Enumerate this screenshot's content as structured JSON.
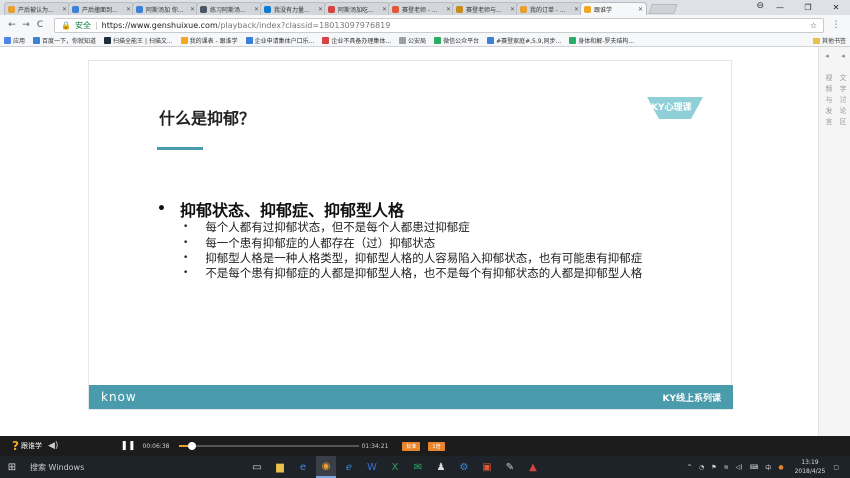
{
  "browser": {
    "tabs": [
      {
        "label": "产后被认为...",
        "icon": "user-icon",
        "color": "#e8a030"
      },
      {
        "label": "产后撞面到...",
        "icon": "paw-icon",
        "color": "#3b82d6"
      },
      {
        "label": "阿斯汤加 你...",
        "icon": "paw-icon",
        "color": "#3b82d6"
      },
      {
        "label": "练习阿斯汤...",
        "icon": "doc-icon",
        "color": "#4b5563"
      },
      {
        "label": "我没有力量...",
        "icon": "zhihu-icon",
        "color": "#0e7bd2"
      },
      {
        "label": "阿斯汤加吃...",
        "icon": "doc-icon",
        "color": "#d64541"
      },
      {
        "label": "赛登老师 - ...",
        "icon": "circle-icon",
        "color": "#e05a3a"
      },
      {
        "label": "赛登老师与...",
        "icon": "book-icon",
        "color": "#c98a1c"
      },
      {
        "label": "我的订单 - ...",
        "icon": "order-icon",
        "color": "#e8a030"
      },
      {
        "label": "跟谁学",
        "icon": "question-icon",
        "color": "#f5a623",
        "active": true
      }
    ],
    "url_secure_label": "安全",
    "url_host": "https://www.genshuixue.com",
    "url_path": "/playback/index?classid=18013097976819",
    "bookmarks": [
      {
        "label": "应用",
        "color": "#4f86e8"
      },
      {
        "label": "百度一下，你就知道",
        "color": "#3b82d6"
      },
      {
        "label": "扫描全能王 | 扫描文...",
        "color": "#1d2b3a"
      },
      {
        "label": "我的课表 - 跟谁学",
        "color": "#f5a623"
      },
      {
        "label": "企业申请集体户口乐...",
        "color": "#3b82d6"
      },
      {
        "label": "企业不具备办理集体...",
        "color": "#d64541"
      },
      {
        "label": "公安局",
        "color": "#9aa0a6"
      },
      {
        "label": "微信公众平台",
        "color": "#2aae67"
      },
      {
        "label": "#赛登家庭#,5.9,同步...",
        "color": "#3b82d6"
      },
      {
        "label": "身体和解-罗夫结构...",
        "color": "#2aae67"
      }
    ],
    "other_bookmarks": "其他书签"
  },
  "slide": {
    "title": "什么是抑郁？",
    "logo": "KY心理课",
    "main_point": "抑郁状态、抑郁症、抑郁型人格",
    "sub_points": [
      "每个人都有过抑郁状态，但不是每个人都患过抑郁症",
      "每一个患有抑郁症的人都存在（过）抑郁状态",
      "抑郁型人格是一种人格类型，抑郁型人格的人容易陷入抑郁状态，也有可能患有抑郁症",
      "不是每个患有抑郁症的人都是抑郁型人格，也不是每个有抑郁状态的人都是抑郁型人格"
    ],
    "footer_brand": "know",
    "footer_series": "KY线上系列课"
  },
  "side_panel": {
    "col1": [
      "视",
      "频",
      "与",
      "发",
      "言"
    ],
    "col2": [
      "文",
      "字",
      "讨",
      "论",
      "区"
    ]
  },
  "player": {
    "logo": "跟谁学",
    "current_time": "00:06:38",
    "duration": "01:34:21",
    "progress": 0.07,
    "rate_button": "标准",
    "speed_button": "1倍"
  },
  "taskbar": {
    "search_placeholder": "搜索 Windows",
    "time": "13:19",
    "date": "2018/4/25",
    "ime": "中"
  }
}
